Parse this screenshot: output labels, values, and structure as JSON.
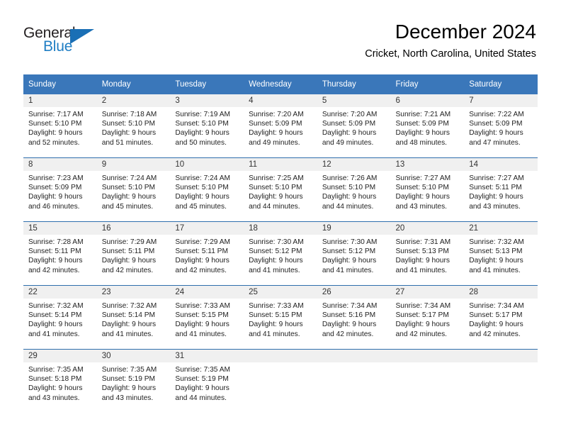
{
  "brand": {
    "name_part1": "General",
    "name_part2": "Blue",
    "accent_color": "#1a6fb5"
  },
  "header": {
    "title": "December 2024",
    "subtitle": "Cricket, North Carolina, United States"
  },
  "calendar": {
    "header_bg": "#3a77ba",
    "daynum_bg": "#f0f0f0",
    "weekday_headers": [
      "Sunday",
      "Monday",
      "Tuesday",
      "Wednesday",
      "Thursday",
      "Friday",
      "Saturday"
    ],
    "weeks": [
      [
        {
          "day": "1",
          "sunrise": "Sunrise: 7:17 AM",
          "sunset": "Sunset: 5:10 PM",
          "daylight_line1": "Daylight: 9 hours",
          "daylight_line2": "and 52 minutes."
        },
        {
          "day": "2",
          "sunrise": "Sunrise: 7:18 AM",
          "sunset": "Sunset: 5:10 PM",
          "daylight_line1": "Daylight: 9 hours",
          "daylight_line2": "and 51 minutes."
        },
        {
          "day": "3",
          "sunrise": "Sunrise: 7:19 AM",
          "sunset": "Sunset: 5:10 PM",
          "daylight_line1": "Daylight: 9 hours",
          "daylight_line2": "and 50 minutes."
        },
        {
          "day": "4",
          "sunrise": "Sunrise: 7:20 AM",
          "sunset": "Sunset: 5:09 PM",
          "daylight_line1": "Daylight: 9 hours",
          "daylight_line2": "and 49 minutes."
        },
        {
          "day": "5",
          "sunrise": "Sunrise: 7:20 AM",
          "sunset": "Sunset: 5:09 PM",
          "daylight_line1": "Daylight: 9 hours",
          "daylight_line2": "and 49 minutes."
        },
        {
          "day": "6",
          "sunrise": "Sunrise: 7:21 AM",
          "sunset": "Sunset: 5:09 PM",
          "daylight_line1": "Daylight: 9 hours",
          "daylight_line2": "and 48 minutes."
        },
        {
          "day": "7",
          "sunrise": "Sunrise: 7:22 AM",
          "sunset": "Sunset: 5:09 PM",
          "daylight_line1": "Daylight: 9 hours",
          "daylight_line2": "and 47 minutes."
        }
      ],
      [
        {
          "day": "8",
          "sunrise": "Sunrise: 7:23 AM",
          "sunset": "Sunset: 5:09 PM",
          "daylight_line1": "Daylight: 9 hours",
          "daylight_line2": "and 46 minutes."
        },
        {
          "day": "9",
          "sunrise": "Sunrise: 7:24 AM",
          "sunset": "Sunset: 5:10 PM",
          "daylight_line1": "Daylight: 9 hours",
          "daylight_line2": "and 45 minutes."
        },
        {
          "day": "10",
          "sunrise": "Sunrise: 7:24 AM",
          "sunset": "Sunset: 5:10 PM",
          "daylight_line1": "Daylight: 9 hours",
          "daylight_line2": "and 45 minutes."
        },
        {
          "day": "11",
          "sunrise": "Sunrise: 7:25 AM",
          "sunset": "Sunset: 5:10 PM",
          "daylight_line1": "Daylight: 9 hours",
          "daylight_line2": "and 44 minutes."
        },
        {
          "day": "12",
          "sunrise": "Sunrise: 7:26 AM",
          "sunset": "Sunset: 5:10 PM",
          "daylight_line1": "Daylight: 9 hours",
          "daylight_line2": "and 44 minutes."
        },
        {
          "day": "13",
          "sunrise": "Sunrise: 7:27 AM",
          "sunset": "Sunset: 5:10 PM",
          "daylight_line1": "Daylight: 9 hours",
          "daylight_line2": "and 43 minutes."
        },
        {
          "day": "14",
          "sunrise": "Sunrise: 7:27 AM",
          "sunset": "Sunset: 5:11 PM",
          "daylight_line1": "Daylight: 9 hours",
          "daylight_line2": "and 43 minutes."
        }
      ],
      [
        {
          "day": "15",
          "sunrise": "Sunrise: 7:28 AM",
          "sunset": "Sunset: 5:11 PM",
          "daylight_line1": "Daylight: 9 hours",
          "daylight_line2": "and 42 minutes."
        },
        {
          "day": "16",
          "sunrise": "Sunrise: 7:29 AM",
          "sunset": "Sunset: 5:11 PM",
          "daylight_line1": "Daylight: 9 hours",
          "daylight_line2": "and 42 minutes."
        },
        {
          "day": "17",
          "sunrise": "Sunrise: 7:29 AM",
          "sunset": "Sunset: 5:11 PM",
          "daylight_line1": "Daylight: 9 hours",
          "daylight_line2": "and 42 minutes."
        },
        {
          "day": "18",
          "sunrise": "Sunrise: 7:30 AM",
          "sunset": "Sunset: 5:12 PM",
          "daylight_line1": "Daylight: 9 hours",
          "daylight_line2": "and 41 minutes."
        },
        {
          "day": "19",
          "sunrise": "Sunrise: 7:30 AM",
          "sunset": "Sunset: 5:12 PM",
          "daylight_line1": "Daylight: 9 hours",
          "daylight_line2": "and 41 minutes."
        },
        {
          "day": "20",
          "sunrise": "Sunrise: 7:31 AM",
          "sunset": "Sunset: 5:13 PM",
          "daylight_line1": "Daylight: 9 hours",
          "daylight_line2": "and 41 minutes."
        },
        {
          "day": "21",
          "sunrise": "Sunrise: 7:32 AM",
          "sunset": "Sunset: 5:13 PM",
          "daylight_line1": "Daylight: 9 hours",
          "daylight_line2": "and 41 minutes."
        }
      ],
      [
        {
          "day": "22",
          "sunrise": "Sunrise: 7:32 AM",
          "sunset": "Sunset: 5:14 PM",
          "daylight_line1": "Daylight: 9 hours",
          "daylight_line2": "and 41 minutes."
        },
        {
          "day": "23",
          "sunrise": "Sunrise: 7:32 AM",
          "sunset": "Sunset: 5:14 PM",
          "daylight_line1": "Daylight: 9 hours",
          "daylight_line2": "and 41 minutes."
        },
        {
          "day": "24",
          "sunrise": "Sunrise: 7:33 AM",
          "sunset": "Sunset: 5:15 PM",
          "daylight_line1": "Daylight: 9 hours",
          "daylight_line2": "and 41 minutes."
        },
        {
          "day": "25",
          "sunrise": "Sunrise: 7:33 AM",
          "sunset": "Sunset: 5:15 PM",
          "daylight_line1": "Daylight: 9 hours",
          "daylight_line2": "and 41 minutes."
        },
        {
          "day": "26",
          "sunrise": "Sunrise: 7:34 AM",
          "sunset": "Sunset: 5:16 PM",
          "daylight_line1": "Daylight: 9 hours",
          "daylight_line2": "and 42 minutes."
        },
        {
          "day": "27",
          "sunrise": "Sunrise: 7:34 AM",
          "sunset": "Sunset: 5:17 PM",
          "daylight_line1": "Daylight: 9 hours",
          "daylight_line2": "and 42 minutes."
        },
        {
          "day": "28",
          "sunrise": "Sunrise: 7:34 AM",
          "sunset": "Sunset: 5:17 PM",
          "daylight_line1": "Daylight: 9 hours",
          "daylight_line2": "and 42 minutes."
        }
      ],
      [
        {
          "day": "29",
          "sunrise": "Sunrise: 7:35 AM",
          "sunset": "Sunset: 5:18 PM",
          "daylight_line1": "Daylight: 9 hours",
          "daylight_line2": "and 43 minutes."
        },
        {
          "day": "30",
          "sunrise": "Sunrise: 7:35 AM",
          "sunset": "Sunset: 5:19 PM",
          "daylight_line1": "Daylight: 9 hours",
          "daylight_line2": "and 43 minutes."
        },
        {
          "day": "31",
          "sunrise": "Sunrise: 7:35 AM",
          "sunset": "Sunset: 5:19 PM",
          "daylight_line1": "Daylight: 9 hours",
          "daylight_line2": "and 44 minutes."
        },
        {
          "day": "",
          "sunrise": "",
          "sunset": "",
          "daylight_line1": "",
          "daylight_line2": ""
        },
        {
          "day": "",
          "sunrise": "",
          "sunset": "",
          "daylight_line1": "",
          "daylight_line2": ""
        },
        {
          "day": "",
          "sunrise": "",
          "sunset": "",
          "daylight_line1": "",
          "daylight_line2": ""
        },
        {
          "day": "",
          "sunrise": "",
          "sunset": "",
          "daylight_line1": "",
          "daylight_line2": ""
        }
      ]
    ]
  }
}
